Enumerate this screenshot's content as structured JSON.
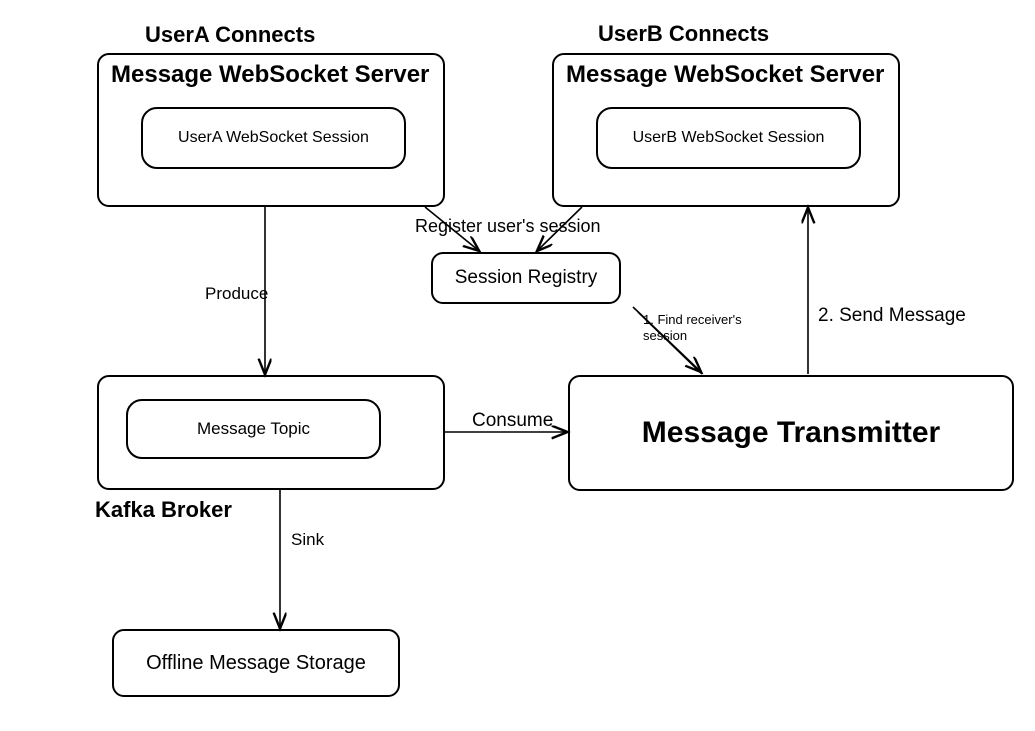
{
  "headers": {
    "userA": "UserA Connects",
    "userB": "UserB Connects"
  },
  "serverA": {
    "title": "Message WebSocket Server",
    "session": "UserA WebSocket Session"
  },
  "serverB": {
    "title": "Message WebSocket Server",
    "session": "UserB WebSocket Session"
  },
  "sessionRegistry": "Session Registry",
  "kafka": {
    "label": "Kafka Broker",
    "topic": "Message Topic"
  },
  "transmitter": "Message Transmitter",
  "offlineStorage": "Offline Message Storage",
  "edges": {
    "register": "Register user's session",
    "produce": "Produce",
    "consume": "Consume",
    "sink": "Sink",
    "findReceiver": "1. Find receiver's session",
    "sendMessage": "2. Send Message"
  }
}
